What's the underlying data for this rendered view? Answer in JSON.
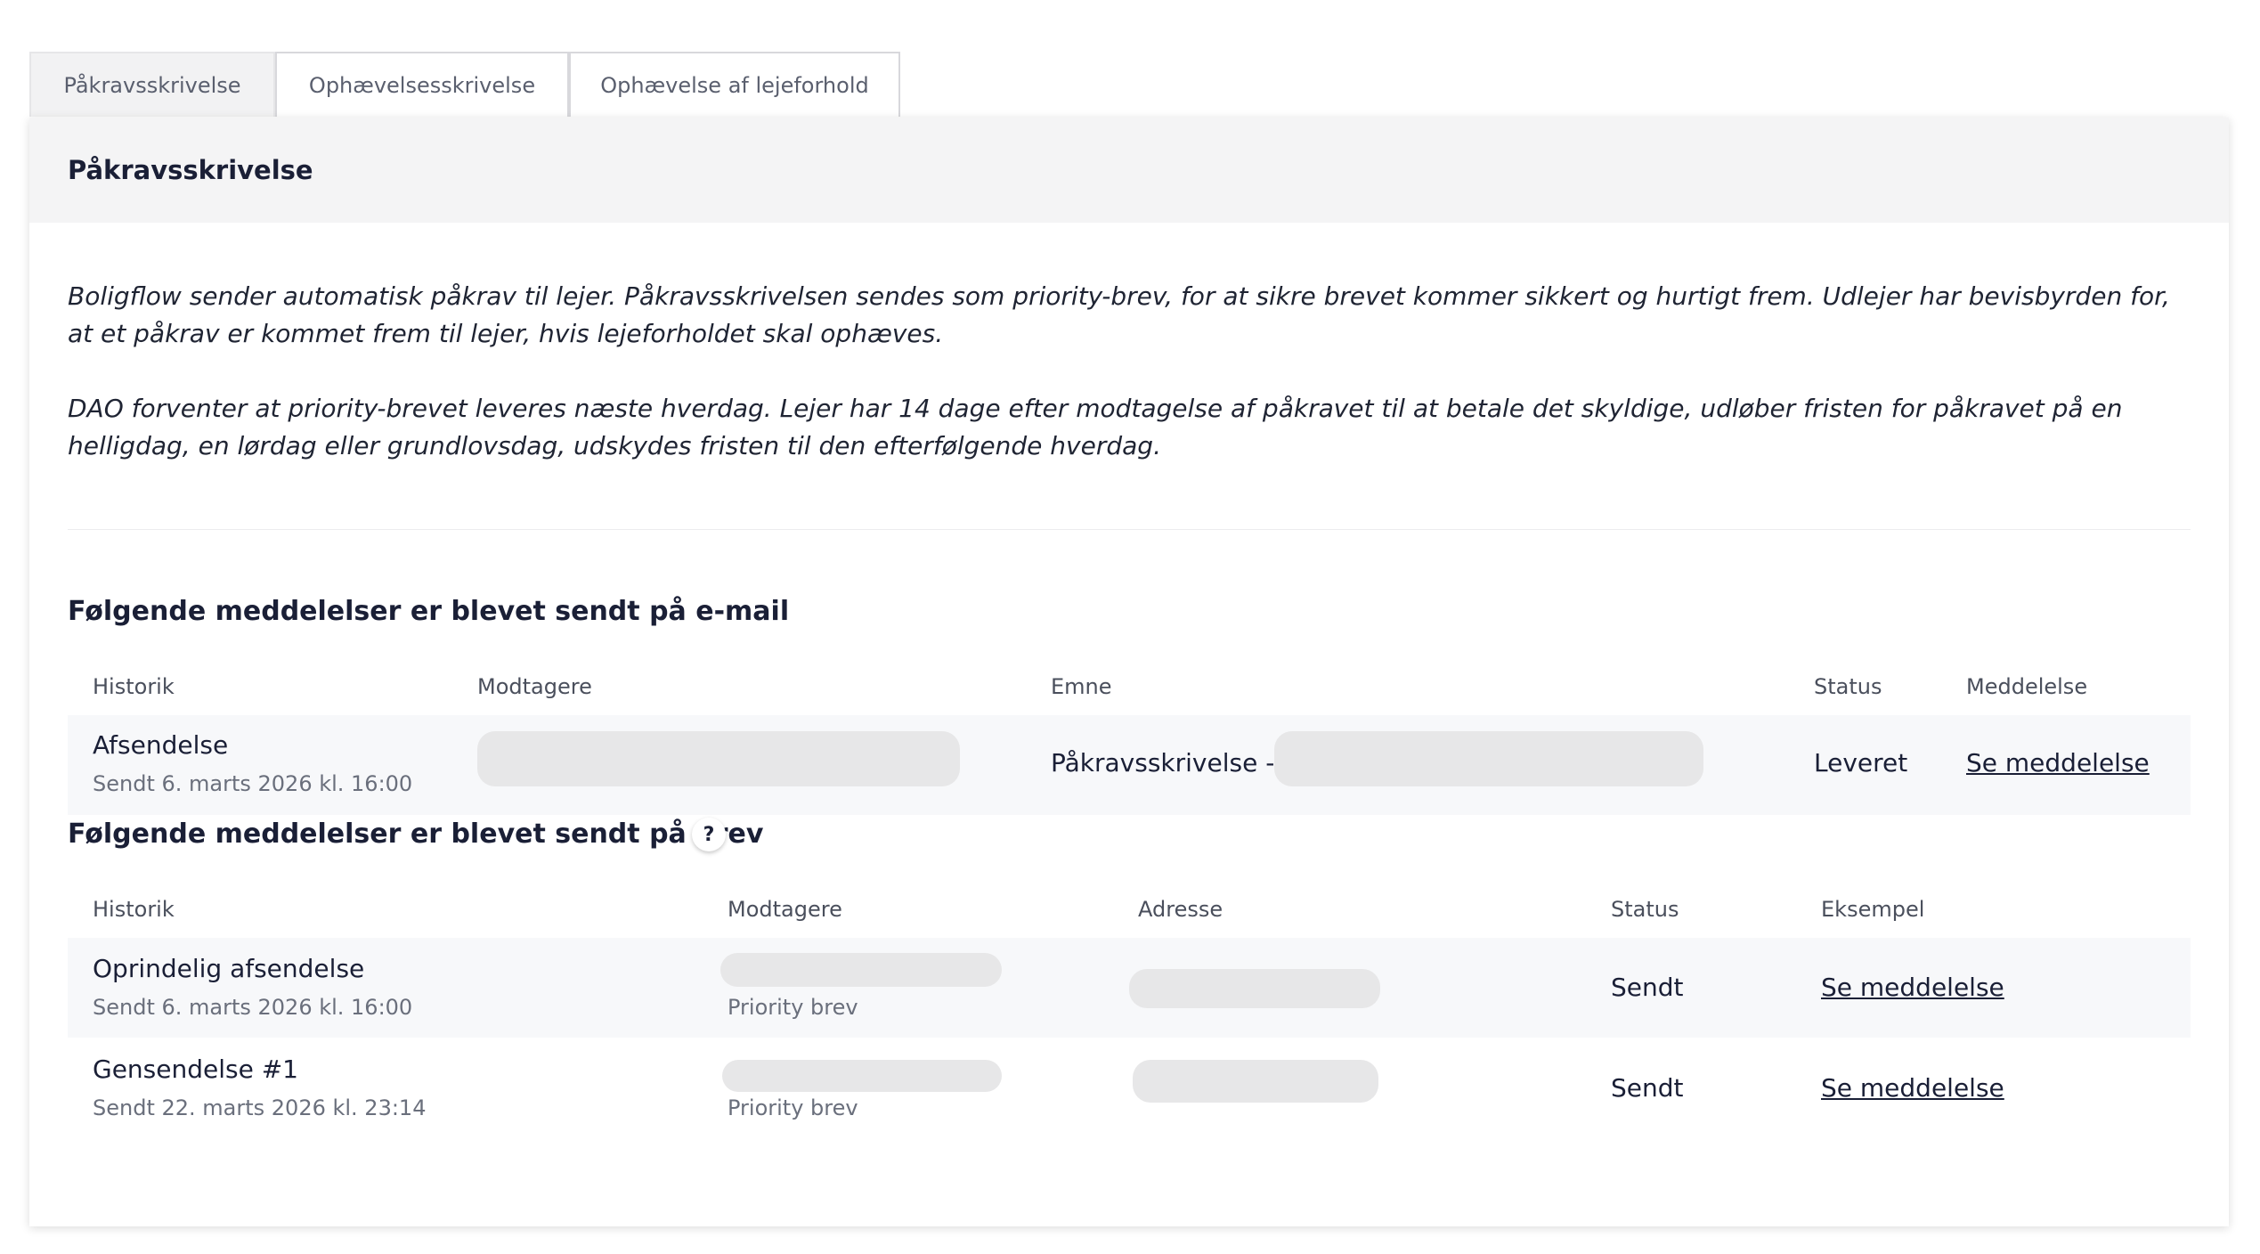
{
  "tabs": [
    {
      "label": "Påkravsskrivelse",
      "active": true
    },
    {
      "label": "Ophævelsesskrivelse",
      "active": false
    },
    {
      "label": "Ophævelse af lejeforhold",
      "active": false
    }
  ],
  "card": {
    "title": "Påkravsskrivelse",
    "intro": [
      "Boligflow sender automatisk påkrav til lejer. Påkravsskrivelsen sendes som priority-brev, for at sikre brevet kommer sikkert og hurtigt frem. Udlejer har bevisbyrden for, at et påkrav er kommet frem til lejer, hvis lejeforholdet skal ophæves.",
      "DAO forventer at priority-brevet leveres næste hverdag. Lejer har 14 dage efter modtagelse af påkravet til at betale det skyldige, udløber fristen for påkravet på en helligdag, en lørdag eller grundlovsdag, udskydes fristen til den efterfølgende hverdag."
    ]
  },
  "email_section": {
    "title": "Følgende meddelelser er blevet sendt på e-mail",
    "headers": [
      "Historik",
      "Modtagere",
      "Emne",
      "Status",
      "Meddelelse"
    ],
    "rows": [
      {
        "event": "Afsendelse",
        "sent": "Sendt 6. marts 2026 kl. 16:00",
        "subject_prefix": "Påkravsskrivelse -",
        "status": "Leveret",
        "link": "Se meddelelse"
      }
    ]
  },
  "letter_section": {
    "title": "Følgende meddelelser er blevet sendt på brev",
    "help_icon": "?",
    "headers": [
      "Historik",
      "Modtagere",
      "Adresse",
      "Status",
      "Eksempel"
    ],
    "rows": [
      {
        "event": "Oprindelig afsendelse",
        "sent": "Sendt 6. marts 2026 kl. 16:00",
        "method": "Priority brev",
        "status": "Sendt",
        "link": "Se meddelelse"
      },
      {
        "event": "Gensendelse #1",
        "sent": "Sendt 22. marts 2026 kl. 23:14",
        "method": "Priority brev",
        "status": "Sendt",
        "link": "Se meddelelse"
      }
    ]
  }
}
